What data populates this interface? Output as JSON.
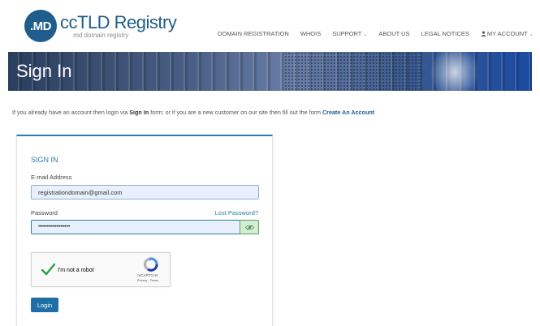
{
  "header": {
    "logo_badge": ".MD",
    "logo_title": "ccTLD Registry",
    "logo_subtitle": ".md domain registry",
    "nav": [
      {
        "label": "DOMAIN REGISTRATION",
        "has_dropdown": false
      },
      {
        "label": "WHOIS",
        "has_dropdown": false
      },
      {
        "label": "SUPPORT",
        "has_dropdown": true
      },
      {
        "label": "ABOUT US",
        "has_dropdown": false
      },
      {
        "label": "LEGAL NOTICES",
        "has_dropdown": false
      },
      {
        "label": "MY ACCOUNT",
        "has_dropdown": true,
        "icon": "user-icon"
      }
    ]
  },
  "banner": {
    "title": "Sign In"
  },
  "intro": {
    "text_before": "If you already have an account then login via ",
    "bold_text": "Sign In",
    "text_after": " form; or if you are a new customer on our site then fill out the form ",
    "link_text": "Create An Account"
  },
  "form": {
    "title": "SIGN IN",
    "email_label": "E-mail Address",
    "email_value": "registrationdomain@gmail.com",
    "password_label": "Password",
    "lost_password": "Lost Password?",
    "password_value": "•••••••••••••••••••••••",
    "show_password_icon": "eye-icon",
    "login_label": "Login"
  },
  "captcha": {
    "label": "I'm not a robot",
    "checked": true,
    "brand": "reCAPTCHA",
    "terms": "Privacy - Terms"
  },
  "colors": {
    "brand_blue": "#1f5d8c",
    "accent_teal": "#2a7fa5",
    "button_blue": "#1f6fa6",
    "check_green": "#2e9e4a"
  }
}
